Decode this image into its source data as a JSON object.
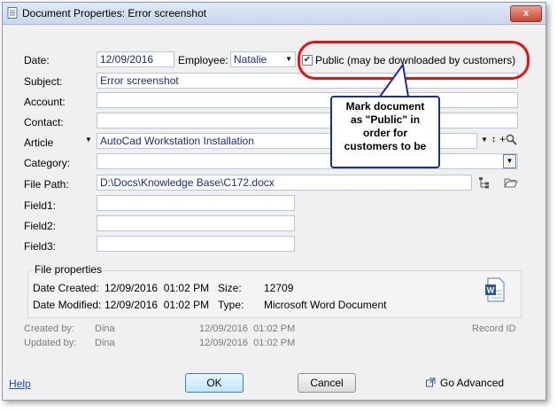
{
  "window": {
    "title": "Document Properties: Error screenshot",
    "close_label": "x"
  },
  "form": {
    "date_label": "Date:",
    "date_value": "12/09/2016",
    "employee_label": "Employee:",
    "employee_value": "Natalie",
    "public_label": "Public (may be downloaded by customers)",
    "public_checked": true,
    "subject_label": "Subject:",
    "subject_value": "Error screenshot",
    "account_label": "Account:",
    "contact_label": "Contact:",
    "article_label": "Article",
    "article_value": "AutoCad Workstation Installation",
    "category_label": "Category:",
    "filepath_label": "File Path:",
    "filepath_value": "D:\\Docs\\Knowledge Base\\C172.docx",
    "field1_label": "Field1:",
    "field2_label": "Field2:",
    "field3_label": "Field3:"
  },
  "callout": {
    "lines": [
      "Mark document",
      "as \"Public\" in",
      "order for",
      "customers to be"
    ]
  },
  "file_properties": {
    "title": "File properties",
    "date_created_label": "Date Created:",
    "date_created_value": "12/09/2016  01:02 PM",
    "size_label": "Size:",
    "size_value": "12709",
    "date_modified_label": "Date Modified:",
    "date_modified_value": "12/09/2016  01:02 PM",
    "type_label": "Type:",
    "type_value": "Microsoft Word Document"
  },
  "audit": {
    "created_by_label": "Created by:",
    "created_by_value": "Dina",
    "created_time": "12/09/2016  01:02 PM",
    "updated_by_label": "Updated by:",
    "updated_by_value": "Dina",
    "updated_time": "12/09/2016  01:02 PM",
    "record_id_label": "Record ID"
  },
  "buttons": {
    "help": "Help",
    "ok": "OK",
    "cancel": "Cancel",
    "go_advanced": "Go Advanced"
  },
  "colors": {
    "highlight": "#e01515",
    "callout_border": "#1b2f8f",
    "value_text": "#1a2a8c"
  }
}
